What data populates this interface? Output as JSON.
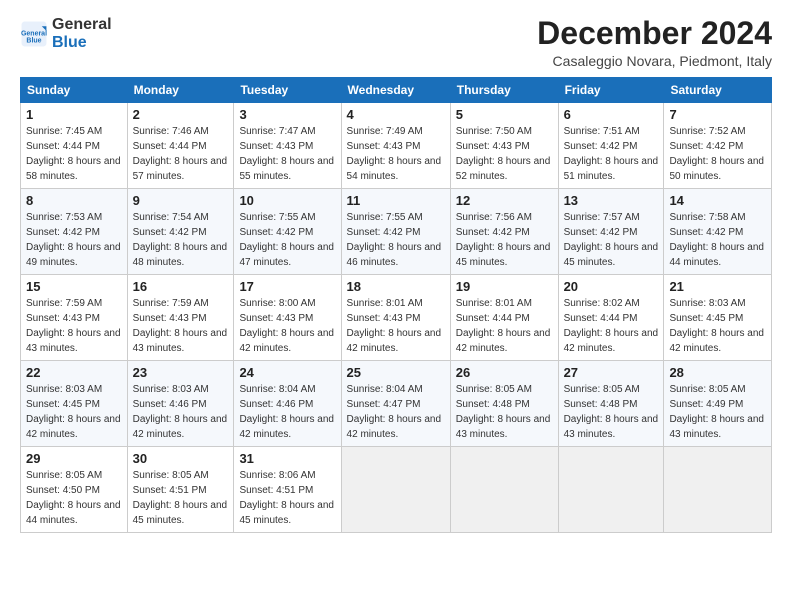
{
  "logo": {
    "line1": "General",
    "line2": "Blue"
  },
  "title": "December 2024",
  "location": "Casaleggio Novara, Piedmont, Italy",
  "weekdays": [
    "Sunday",
    "Monday",
    "Tuesday",
    "Wednesday",
    "Thursday",
    "Friday",
    "Saturday"
  ],
  "weeks": [
    [
      {
        "day": "1",
        "sunrise": "7:45 AM",
        "sunset": "4:44 PM",
        "daylight": "8 hours and 58 minutes."
      },
      {
        "day": "2",
        "sunrise": "7:46 AM",
        "sunset": "4:44 PM",
        "daylight": "8 hours and 57 minutes."
      },
      {
        "day": "3",
        "sunrise": "7:47 AM",
        "sunset": "4:43 PM",
        "daylight": "8 hours and 55 minutes."
      },
      {
        "day": "4",
        "sunrise": "7:49 AM",
        "sunset": "4:43 PM",
        "daylight": "8 hours and 54 minutes."
      },
      {
        "day": "5",
        "sunrise": "7:50 AM",
        "sunset": "4:43 PM",
        "daylight": "8 hours and 52 minutes."
      },
      {
        "day": "6",
        "sunrise": "7:51 AM",
        "sunset": "4:42 PM",
        "daylight": "8 hours and 51 minutes."
      },
      {
        "day": "7",
        "sunrise": "7:52 AM",
        "sunset": "4:42 PM",
        "daylight": "8 hours and 50 minutes."
      }
    ],
    [
      {
        "day": "8",
        "sunrise": "7:53 AM",
        "sunset": "4:42 PM",
        "daylight": "8 hours and 49 minutes."
      },
      {
        "day": "9",
        "sunrise": "7:54 AM",
        "sunset": "4:42 PM",
        "daylight": "8 hours and 48 minutes."
      },
      {
        "day": "10",
        "sunrise": "7:55 AM",
        "sunset": "4:42 PM",
        "daylight": "8 hours and 47 minutes."
      },
      {
        "day": "11",
        "sunrise": "7:55 AM",
        "sunset": "4:42 PM",
        "daylight": "8 hours and 46 minutes."
      },
      {
        "day": "12",
        "sunrise": "7:56 AM",
        "sunset": "4:42 PM",
        "daylight": "8 hours and 45 minutes."
      },
      {
        "day": "13",
        "sunrise": "7:57 AM",
        "sunset": "4:42 PM",
        "daylight": "8 hours and 45 minutes."
      },
      {
        "day": "14",
        "sunrise": "7:58 AM",
        "sunset": "4:42 PM",
        "daylight": "8 hours and 44 minutes."
      }
    ],
    [
      {
        "day": "15",
        "sunrise": "7:59 AM",
        "sunset": "4:43 PM",
        "daylight": "8 hours and 43 minutes."
      },
      {
        "day": "16",
        "sunrise": "7:59 AM",
        "sunset": "4:43 PM",
        "daylight": "8 hours and 43 minutes."
      },
      {
        "day": "17",
        "sunrise": "8:00 AM",
        "sunset": "4:43 PM",
        "daylight": "8 hours and 42 minutes."
      },
      {
        "day": "18",
        "sunrise": "8:01 AM",
        "sunset": "4:43 PM",
        "daylight": "8 hours and 42 minutes."
      },
      {
        "day": "19",
        "sunrise": "8:01 AM",
        "sunset": "4:44 PM",
        "daylight": "8 hours and 42 minutes."
      },
      {
        "day": "20",
        "sunrise": "8:02 AM",
        "sunset": "4:44 PM",
        "daylight": "8 hours and 42 minutes."
      },
      {
        "day": "21",
        "sunrise": "8:03 AM",
        "sunset": "4:45 PM",
        "daylight": "8 hours and 42 minutes."
      }
    ],
    [
      {
        "day": "22",
        "sunrise": "8:03 AM",
        "sunset": "4:45 PM",
        "daylight": "8 hours and 42 minutes."
      },
      {
        "day": "23",
        "sunrise": "8:03 AM",
        "sunset": "4:46 PM",
        "daylight": "8 hours and 42 minutes."
      },
      {
        "day": "24",
        "sunrise": "8:04 AM",
        "sunset": "4:46 PM",
        "daylight": "8 hours and 42 minutes."
      },
      {
        "day": "25",
        "sunrise": "8:04 AM",
        "sunset": "4:47 PM",
        "daylight": "8 hours and 42 minutes."
      },
      {
        "day": "26",
        "sunrise": "8:05 AM",
        "sunset": "4:48 PM",
        "daylight": "8 hours and 43 minutes."
      },
      {
        "day": "27",
        "sunrise": "8:05 AM",
        "sunset": "4:48 PM",
        "daylight": "8 hours and 43 minutes."
      },
      {
        "day": "28",
        "sunrise": "8:05 AM",
        "sunset": "4:49 PM",
        "daylight": "8 hours and 43 minutes."
      }
    ],
    [
      {
        "day": "29",
        "sunrise": "8:05 AM",
        "sunset": "4:50 PM",
        "daylight": "8 hours and 44 minutes."
      },
      {
        "day": "30",
        "sunrise": "8:05 AM",
        "sunset": "4:51 PM",
        "daylight": "8 hours and 45 minutes."
      },
      {
        "day": "31",
        "sunrise": "8:06 AM",
        "sunset": "4:51 PM",
        "daylight": "8 hours and 45 minutes."
      },
      null,
      null,
      null,
      null
    ]
  ]
}
